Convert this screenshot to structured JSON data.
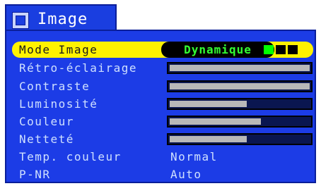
{
  "menu": {
    "title": "Image",
    "icon": "display-icon",
    "selected_item": {
      "label": "Mode Image",
      "value": "Dynamique",
      "mode_indicators": [
        true,
        false,
        false
      ]
    },
    "sliders": [
      {
        "label": "Rétro-éclairage",
        "level": 1.0
      },
      {
        "label": "Contraste",
        "level": 1.0
      },
      {
        "label": "Luminosité",
        "level": 0.55
      },
      {
        "label": "Couleur",
        "level": 0.65
      },
      {
        "label": "Netteté",
        "level": 0.55
      }
    ],
    "text_items": [
      {
        "label": "Temp. couleur",
        "value": "Normal"
      },
      {
        "label": "P-NR",
        "value": "Auto"
      }
    ]
  },
  "colors": {
    "panel": "#1c3ce6",
    "highlight": "#fff200",
    "value_text": "#33ff33",
    "indicator_on": "#00ff00"
  }
}
